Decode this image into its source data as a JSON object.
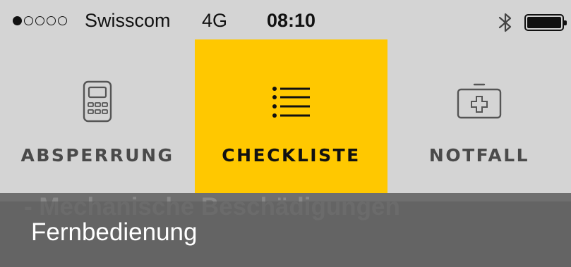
{
  "statusbar": {
    "signal_filled": 1,
    "signal_total": 5,
    "carrier": "Swisscom",
    "network": "4G",
    "time": "08:10",
    "bluetooth_icon": "bluetooth-icon",
    "battery_level": 1.0
  },
  "tabs": [
    {
      "label": "ABSPERRUNG",
      "icon": "remote-control-icon",
      "active": false
    },
    {
      "label": "CHECKLISTE",
      "icon": "list-icon",
      "active": true
    },
    {
      "label": "NOTFALL",
      "icon": "first-aid-kit-icon",
      "active": false
    }
  ],
  "content": {
    "ghost_text": "- Mechanische Beschädigungen",
    "section_title": "Fernbedienung"
  },
  "colors": {
    "active_tab": "#ffc800",
    "background": "#d4d4d4",
    "header": "#606060"
  }
}
